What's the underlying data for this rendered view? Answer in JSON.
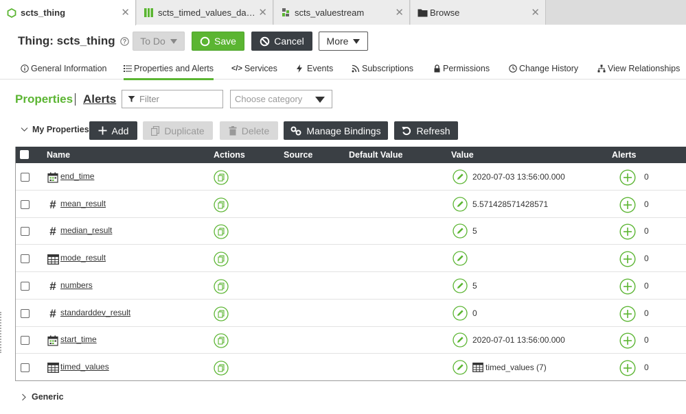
{
  "tabs": [
    {
      "label": "scts_thing",
      "icon": "thing-hexagon-icon",
      "active": true
    },
    {
      "label": "scts_timed_values_datas…",
      "icon": "datashape-icon",
      "active": false
    },
    {
      "label": "scts_valuestream",
      "icon": "valuestream-icon",
      "active": false
    },
    {
      "label": "Browse",
      "icon": "folder-icon",
      "active": false
    }
  ],
  "header": {
    "title": "Thing: scts_thing",
    "todo_label": "To Do",
    "save_label": "Save",
    "cancel_label": "Cancel",
    "more_label": "More"
  },
  "nav": [
    {
      "label": "General Information",
      "icon": "info-icon"
    },
    {
      "label": "Properties and Alerts",
      "icon": "list-icon",
      "active": true
    },
    {
      "label": "Services",
      "icon": "code-icon"
    },
    {
      "label": "Events",
      "icon": "bolt-icon"
    },
    {
      "label": "Subscriptions",
      "icon": "rss-icon"
    },
    {
      "label": "Permissions",
      "icon": "lock-icon"
    },
    {
      "label": "Change History",
      "icon": "clock-icon"
    },
    {
      "label": "View Relationships",
      "icon": "hierarchy-icon"
    }
  ],
  "subnav": {
    "properties": "Properties",
    "alerts": "Alerts"
  },
  "filter": {
    "placeholder": "Filter"
  },
  "category": {
    "placeholder": "Choose category"
  },
  "toolbar": {
    "group": "My Properties",
    "add": "Add",
    "duplicate": "Duplicate",
    "delete": "Delete",
    "manage_bindings": "Manage Bindings",
    "refresh": "Refresh"
  },
  "grid": {
    "columns": [
      "Name",
      "Actions",
      "Source",
      "Default Value",
      "Value",
      "Alerts"
    ],
    "rows": [
      {
        "name": "end_time",
        "type": "datetime",
        "value": "2020-07-03 13:56:00.000",
        "alerts": "0"
      },
      {
        "name": "mean_result",
        "type": "number",
        "value": "5.571428571428571",
        "alerts": "0"
      },
      {
        "name": "median_result",
        "type": "number",
        "value": "5",
        "alerts": "0"
      },
      {
        "name": "mode_result",
        "type": "infotable",
        "value": "",
        "alerts": "0"
      },
      {
        "name": "numbers",
        "type": "number",
        "value": "5",
        "alerts": "0"
      },
      {
        "name": "standarddev_result",
        "type": "number",
        "value": "0",
        "alerts": "0"
      },
      {
        "name": "start_time",
        "type": "datetime",
        "value": "2020-07-01 13:56:00.000",
        "alerts": "0"
      },
      {
        "name": "timed_values",
        "type": "infotable",
        "value": "timed_values (7)",
        "value_icon": "table-icon",
        "alerts": "0"
      }
    ]
  },
  "generic_group": "Generic",
  "colors": {
    "accent": "#5bb532",
    "dark": "#3a3f44"
  }
}
